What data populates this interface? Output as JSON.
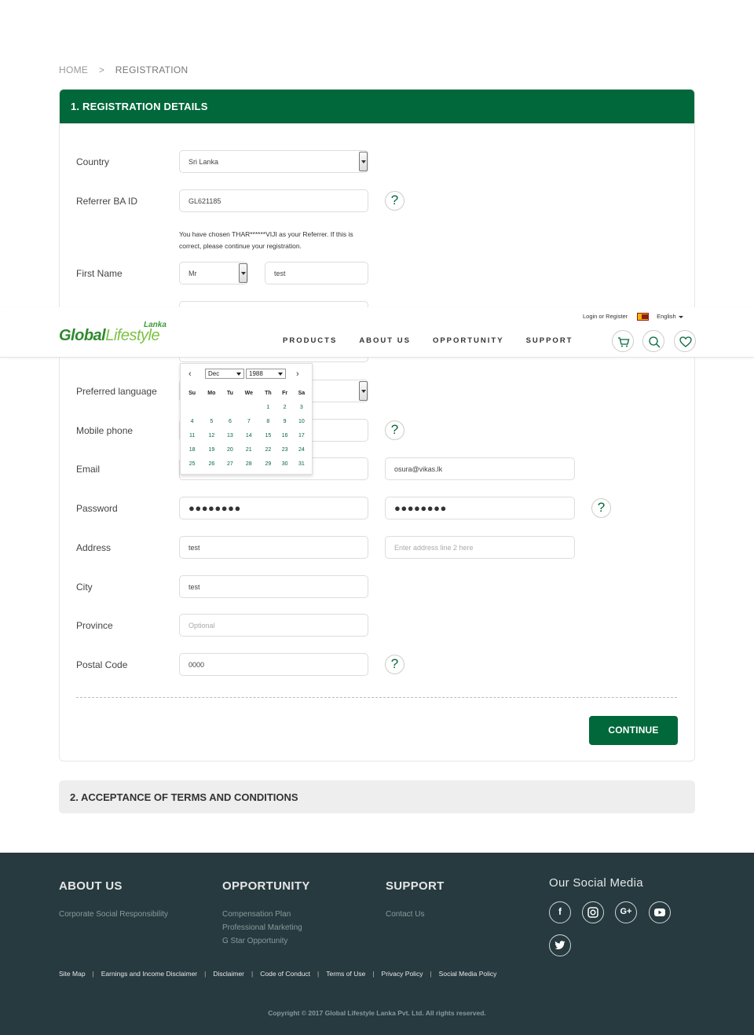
{
  "breadcrumb": {
    "home": "HOME",
    "sep": ">",
    "current": "REGISTRATION"
  },
  "section1": {
    "title": "1. REGISTRATION DETAILS"
  },
  "section2": {
    "title": "2. ACCEPTANCE OF TERMS AND CONDITIONS"
  },
  "form": {
    "country_label": "Country",
    "country_value": "Sri Lanka",
    "referrer_label": "Referrer BA ID",
    "referrer_value": "GL621185",
    "referrer_note": "You have chosen THAR******VIJI as your Referrer. If this is correct, please continue your registration.",
    "firstname_label": "First Name",
    "title_value": "Mr",
    "firstname_value": "test",
    "language_label": "Preferred language",
    "mobile_label": "Mobile phone",
    "email_label": "Email",
    "email_confirm_value": "osura@vikas.lk",
    "password_label": "Password",
    "password_value": "●●●●●●●●",
    "password_confirm_value": "●●●●●●●●",
    "address_label": "Address",
    "address_value": "test",
    "address2_placeholder": "Enter address line 2 here",
    "city_label": "City",
    "city_value": "test",
    "province_label": "Province",
    "province_placeholder": "Optional",
    "postal_label": "Postal Code",
    "postal_value": "0000",
    "help": "?",
    "continue_label": "CONTINUE"
  },
  "datepicker": {
    "prev": "‹",
    "next": "›",
    "month": "Dec",
    "year": "1988",
    "weekdays": [
      "Su",
      "Mo",
      "Tu",
      "We",
      "Th",
      "Fr",
      "Sa"
    ],
    "weeks": [
      [
        "",
        "",
        "",
        "",
        "1",
        "2",
        "3"
      ],
      [
        "4",
        "5",
        "6",
        "7",
        "8",
        "9",
        "10"
      ],
      [
        "11",
        "12",
        "13",
        "14",
        "15",
        "16",
        "17"
      ],
      [
        "18",
        "19",
        "20",
        "21",
        "22",
        "23",
        "24"
      ],
      [
        "25",
        "26",
        "27",
        "28",
        "29",
        "30",
        "31"
      ]
    ]
  },
  "header": {
    "logo_lanka": "Lanka",
    "logo_global": "Global",
    "logo_lifestyle": "Lifestyle",
    "login": "Login or Register",
    "language": "English",
    "nav": [
      "PRODUCTS",
      "ABOUT US",
      "OPPORTUNITY",
      "SUPPORT"
    ],
    "icons": [
      "cart-icon",
      "search-icon",
      "heart-icon"
    ]
  },
  "footer": {
    "about": {
      "title": "ABOUT US",
      "links": [
        "Corporate Social Responsibility"
      ]
    },
    "opportunity": {
      "title": "OPPORTUNITY",
      "links": [
        "Compensation Plan",
        "Professional Marketing",
        "G Star Opportunity"
      ]
    },
    "support": {
      "title": "SUPPORT",
      "links": [
        "Contact Us"
      ]
    },
    "social": {
      "title": "Our Social Media",
      "icons": [
        "facebook-icon",
        "instagram-icon",
        "google-plus-icon",
        "youtube-icon",
        "twitter-icon"
      ]
    },
    "bottom_links": [
      "Site Map",
      "Earnings and Income Disclaimer",
      "Disclaimer",
      "Code of Conduct",
      "Terms of Use",
      "Privacy Policy",
      "Social Media Policy"
    ],
    "copyright": "Copyright © 2017 Global Lifestyle Lanka Pvt. Ltd. All rights reserved."
  },
  "colors": {
    "brand_green": "#00683a",
    "footer_bg": "#263a3f"
  }
}
